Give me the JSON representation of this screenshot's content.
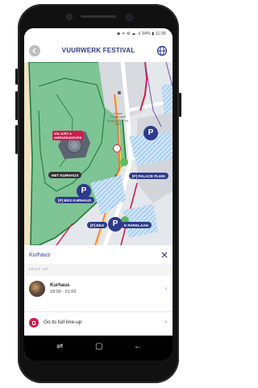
{
  "status_bar": {
    "text": "◉ ✈ ⚙ ☁ .ıl 94% ▮ 11:36"
  },
  "header": {
    "title": "VUURWERK FESTIVAL",
    "back_icon": "back-arrow-icon",
    "globe_icon": "globe-icon"
  },
  "map": {
    "labels": {
      "het_kurhaus": "HET KURHAUS",
      "bks_kurhaus": "[P] BKS KURHAUS",
      "palace_plein": "[P] PALACE PLEIN",
      "bks_parklaan": "[P] BKS",
      "parklaan": "E PARKLAAN",
      "jury": "VIA JURY &\nAMBASSADEURS",
      "palace_promenade": "Palace\nPromenade\nShopping for the\nBest"
    },
    "parking_letter": "P"
  },
  "sheet": {
    "title": "Kurhaus",
    "section_label": "NEXT UP",
    "event": {
      "name": "Kurhaus",
      "time": "18:00 - 01:00"
    },
    "lineup_label": "Go to full line-up"
  },
  "nav": {
    "recents": "⇌",
    "home": "▢",
    "back": "←"
  },
  "colors": {
    "brand": "#2e3a8c",
    "accent": "#d11b4b",
    "link": "#4b8fd6"
  }
}
